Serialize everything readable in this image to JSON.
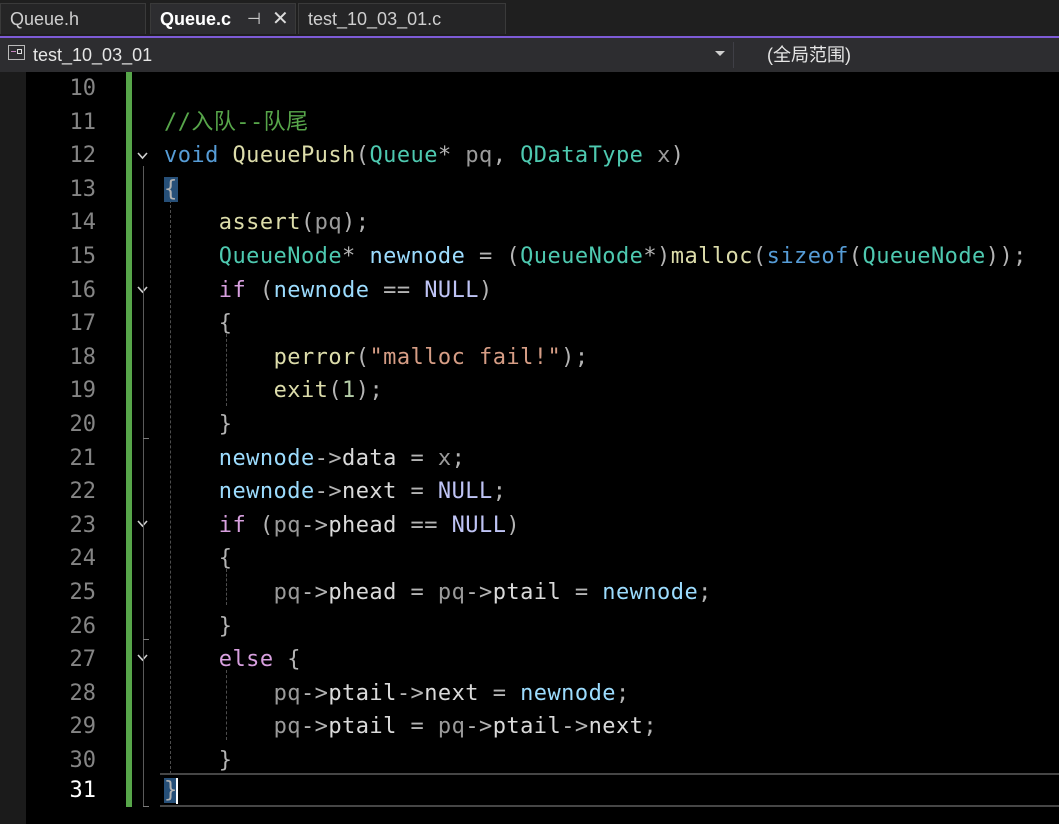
{
  "tabs": [
    {
      "label": "Queue.h",
      "active": false
    },
    {
      "label": "Queue.c",
      "active": true
    },
    {
      "label": "test_10_03_01.c",
      "active": false
    }
  ],
  "tab_icons": {
    "pin": "pin-icon",
    "close": "close-icon"
  },
  "navbar": {
    "project_scope": "test_10_03_01",
    "member_scope": "(全局范围)"
  },
  "editor": {
    "line_numbers": [
      "10",
      "11",
      "12",
      "13",
      "14",
      "15",
      "16",
      "17",
      "18",
      "19",
      "20",
      "21",
      "22",
      "23",
      "24",
      "25",
      "26",
      "27",
      "28",
      "29",
      "30",
      "31"
    ],
    "current_line": "31",
    "lines": {
      "l11": {
        "comment": "//入队--队尾"
      },
      "l12": {
        "kw": "void",
        "fn": "QueuePush",
        "p1": "(",
        "t1": "Queue",
        "p2": "* ",
        "a1": "pq",
        "p3": ", ",
        "t2": "QDataType",
        "p4": " ",
        "a2": "x",
        "p5": ")"
      },
      "l13": {
        "brace": "{"
      },
      "l14": {
        "fn": "assert",
        "p1": "(",
        "a1": "pq",
        "p2": ");"
      },
      "l15": {
        "t1": "QueueNode",
        "p1": "* ",
        "v1": "newnode",
        "p2": " = (",
        "t2": "QueueNode",
        "p3": "*)",
        "fn": "malloc",
        "p4": "(",
        "kw": "sizeof",
        "p5": "(",
        "t3": "QueueNode",
        "p6": "));"
      },
      "l16": {
        "kw": "if",
        "p1": " (",
        "v1": "newnode",
        "p2": " == ",
        "m1": "NULL",
        "p3": ")"
      },
      "l17": {
        "p1": "{"
      },
      "l18": {
        "fn": "perror",
        "p1": "(",
        "s1": "\"malloc fail!\"",
        "p2": ");"
      },
      "l19": {
        "fn": "exit",
        "p1": "(",
        "n1": "1",
        "p2": ");"
      },
      "l20": {
        "p1": "}"
      },
      "l21": {
        "v1": "newnode",
        "p1": "->",
        "f1": "data",
        "p2": " = ",
        "a1": "x",
        "p3": ";"
      },
      "l22": {
        "v1": "newnode",
        "p1": "->",
        "f1": "next",
        "p2": " = ",
        "m1": "NULL",
        "p3": ";"
      },
      "l23": {
        "kw": "if",
        "p1": " (",
        "a1": "pq",
        "p2": "->",
        "f1": "phead",
        "p3": " == ",
        "m1": "NULL",
        "p4": ")"
      },
      "l24": {
        "p1": "{"
      },
      "l25": {
        "a1": "pq",
        "p1": "->",
        "f1": "phead",
        "p2": " = ",
        "a2": "pq",
        "p3": "->",
        "f2": "ptail",
        "p4": " = ",
        "v1": "newnode",
        "p5": ";"
      },
      "l26": {
        "p1": "}"
      },
      "l27": {
        "kw": "else",
        "p1": " {"
      },
      "l28": {
        "a1": "pq",
        "p1": "->",
        "f1": "ptail",
        "p2": "->",
        "f2": "next",
        "p3": " = ",
        "v1": "newnode",
        "p4": ";"
      },
      "l29": {
        "a1": "pq",
        "p1": "->",
        "f1": "ptail",
        "p2": " = ",
        "a2": "pq",
        "p3": "->",
        "f2": "ptail",
        "p4": "->",
        "f3": "next",
        "p5": ";"
      },
      "l30": {
        "p1": "}"
      },
      "l31": {
        "brace": "}"
      }
    }
  },
  "colors": {
    "tab_accent": "#7d5bd6",
    "change_bar": "#57a64a",
    "comment": "#57a64a",
    "keyword": "#569cd6",
    "control_keyword": "#d8a0df",
    "type": "#4ec9b0",
    "function": "#dcdcaa",
    "string": "#d69d85",
    "brace_highlight": "#264f78"
  }
}
